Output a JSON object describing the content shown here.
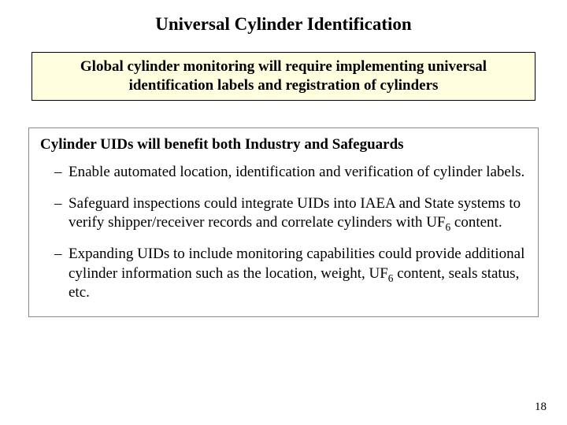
{
  "title": "Universal Cylinder Identification",
  "callout": "Global cylinder monitoring will require implementing universal identification labels and registration of cylinders",
  "lead": "Cylinder UIDs will benefit both Industry and Safeguards",
  "bullets": [
    {
      "pre": "Enable automated location, identification and verification of cylinder labels.",
      "uf6": false,
      "post": ""
    },
    {
      "pre": "Safeguard inspections could integrate UIDs into IAEA and State systems to verify shipper/receiver records and correlate cylinders with UF",
      "uf6": true,
      "post": " content."
    },
    {
      "pre": "Expanding UIDs to include monitoring capabilities could provide additional cylinder information such as the location, weight, UF",
      "uf6": true,
      "post": " content, seals status, etc."
    }
  ],
  "page_number": "18"
}
